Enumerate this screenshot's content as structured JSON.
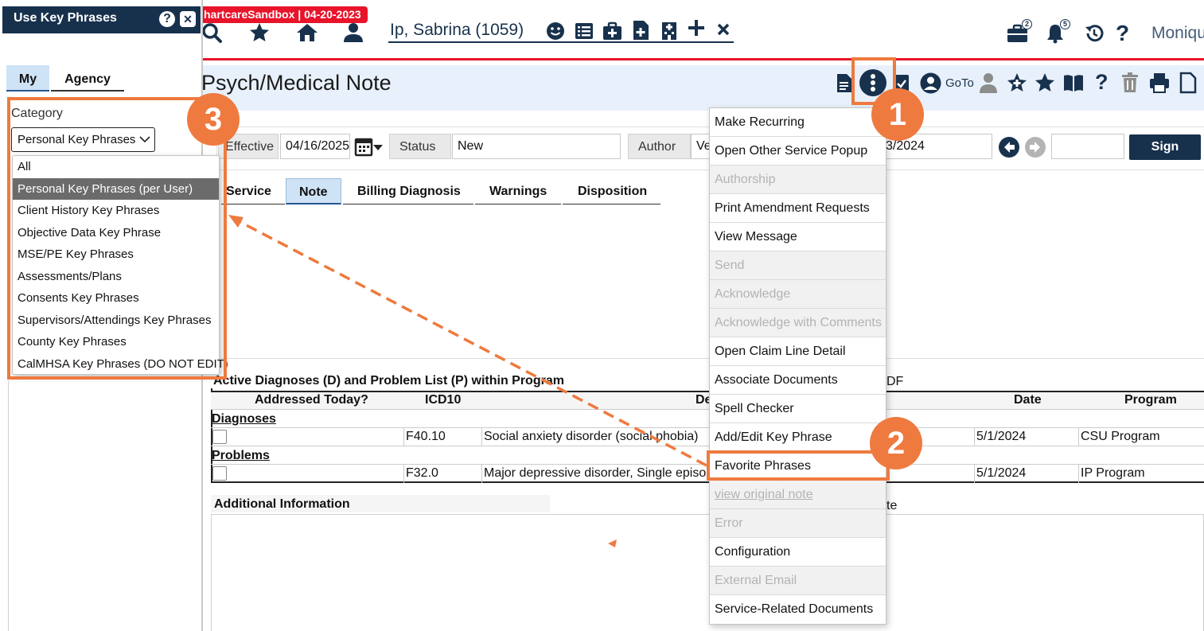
{
  "top_bar": {
    "sandbox_banner": "hartcareSandbox | 04-20-2023",
    "client_name": "Ip, Sabrina (1059)",
    "user_name": "Moniqu",
    "briefcase_count": "2",
    "bell_count": "5"
  },
  "document": {
    "title": "Psych/Medical Note",
    "goto_label": "GoTo"
  },
  "filters": {
    "effective_label": "Effective",
    "effective_value": "04/16/2025",
    "status_label": "Status",
    "status_value": "New",
    "author_label": "Author",
    "author_value": "Ve",
    "date_value": "3/2024",
    "sign_label": "Sign"
  },
  "tabs": [
    "Service",
    "Note",
    "Billing Diagnosis",
    "Warnings",
    "Disposition"
  ],
  "diagnoses": {
    "section_title": "Active Diagnoses (D) and Problem List (P) within Program",
    "extra_label": "DF",
    "columns": {
      "addressed": "Addressed Today?",
      "icd10": "ICD10",
      "description": "De",
      "date": "Date",
      "program": "Program"
    },
    "groups": [
      {
        "label": "Diagnoses",
        "rows": [
          {
            "icd10": "F40.10",
            "description": "Social anxiety disorder (social phobia)",
            "date": "5/1/2024",
            "program": "CSU Program"
          }
        ]
      },
      {
        "label": "Problems",
        "rows": [
          {
            "icd10": "F32.0",
            "description": "Major depressive disorder, Single episo",
            "date": "5/1/2024",
            "program": "IP Program"
          }
        ]
      }
    ]
  },
  "additional_info": {
    "label": "Additional Information",
    "right_fragment": "te"
  },
  "left_panel": {
    "title": "Use Key Phrases",
    "help_button": "?",
    "close_button": "✕",
    "tab_my": "My",
    "tab_agency": "Agency",
    "category_label": "Category",
    "category_value": "Personal Key Phrases",
    "options": [
      "All",
      "Personal Key Phrases (per User)",
      "Client History Key Phrases",
      "Objective Data Key Phrase",
      "MSE/PE Key Phrases",
      "Assessments/Plans",
      "Consents Key Phrases",
      "Supervisors/Attendings Key Phrases",
      "County Key Phrases",
      "CalMHSA Key Phrases (DO NOT EDIT)"
    ],
    "selected_index": 1
  },
  "menu": {
    "items": [
      {
        "label": "Make Recurring",
        "enabled": true
      },
      {
        "label": "Open Other Service Popup",
        "enabled": true
      },
      {
        "label": "Authorship",
        "enabled": false
      },
      {
        "label": "Print Amendment Requests",
        "enabled": true
      },
      {
        "label": "View Message",
        "enabled": true
      },
      {
        "label": "Send",
        "enabled": false
      },
      {
        "label": "Acknowledge",
        "enabled": false
      },
      {
        "label": "Acknowledge with Comments",
        "enabled": false
      },
      {
        "label": "Open Claim Line Detail",
        "enabled": true
      },
      {
        "label": "Associate Documents",
        "enabled": true
      },
      {
        "label": "Spell Checker",
        "enabled": true
      },
      {
        "label": "Add/Edit Key Phrase",
        "enabled": true
      },
      {
        "label": "Favorite Phrases",
        "enabled": true
      },
      {
        "label": "view original note",
        "enabled": false
      },
      {
        "label": "Error",
        "enabled": false
      },
      {
        "label": "Configuration",
        "enabled": true
      },
      {
        "label": "External Email",
        "enabled": false
      },
      {
        "label": "Service-Related Documents",
        "enabled": true
      }
    ]
  },
  "callouts": [
    "1",
    "2",
    "3"
  ],
  "colors": {
    "navy": "#17314d",
    "accent_red": "#e8142a",
    "highlight_orange": "#ee7a3e"
  }
}
